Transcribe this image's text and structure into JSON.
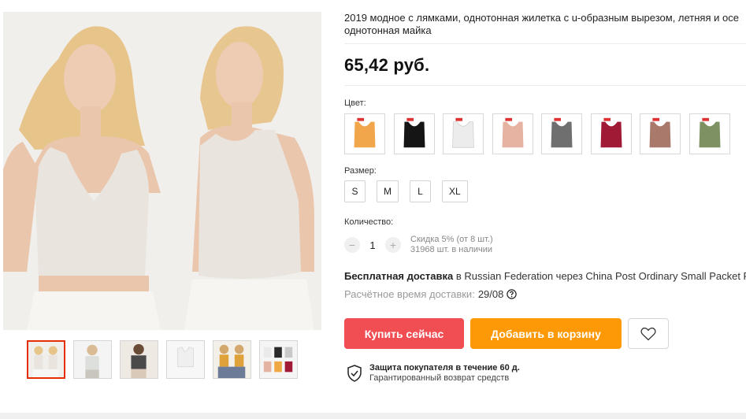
{
  "product": {
    "title_line1": "2019 модное с лямками, однотонная жилетка с u-образным вырезом, летняя и осе",
    "title_line2": "однотонная майка",
    "price": "65,42 руб."
  },
  "gallery": {
    "main_image": "main-product-photo",
    "thumbnails": [
      {
        "name": "thumbnail-1",
        "active": true
      },
      {
        "name": "thumbnail-2",
        "active": false
      },
      {
        "name": "thumbnail-3",
        "active": false
      },
      {
        "name": "thumbnail-4",
        "active": false
      },
      {
        "name": "thumbnail-5",
        "active": false
      },
      {
        "name": "thumbnail-6",
        "active": false
      }
    ]
  },
  "color": {
    "label": "Цвет:",
    "swatches": [
      {
        "name": "orange",
        "hex": "#f2a64b"
      },
      {
        "name": "black",
        "hex": "#151515"
      },
      {
        "name": "white",
        "hex": "#ececec"
      },
      {
        "name": "pink",
        "hex": "#e6b3a3"
      },
      {
        "name": "gray",
        "hex": "#6f6f6f"
      },
      {
        "name": "burgundy",
        "hex": "#a01a35"
      },
      {
        "name": "brown",
        "hex": "#a97a6c"
      },
      {
        "name": "green",
        "hex": "#7d9163"
      }
    ]
  },
  "size": {
    "label": "Размер:",
    "options": [
      "S",
      "M",
      "L",
      "XL"
    ]
  },
  "quantity": {
    "label": "Количество:",
    "value": "1",
    "minus": "−",
    "plus": "+",
    "discount": "Скидка 5% (от 8 шт.)",
    "stock": "31968 шт. в наличии"
  },
  "shipping": {
    "free": "Бесплатная доставка",
    "details": " в Russian Federation через China Post Ordinary Small Packet Plus",
    "estimate_label": "Расчётное время доставки:",
    "estimate_date": "29/08"
  },
  "actions": {
    "buy_now": "Купить сейчас",
    "add_to_cart": "Добавить в корзину"
  },
  "protection": {
    "title": "Защита покупателя в течение 60 д.",
    "subtitle": "Гарантированный возврат средств"
  },
  "colors": {
    "buy_button": "#f14e54",
    "cart_button": "#fd9906",
    "active_thumb_border": "#e62e04"
  }
}
